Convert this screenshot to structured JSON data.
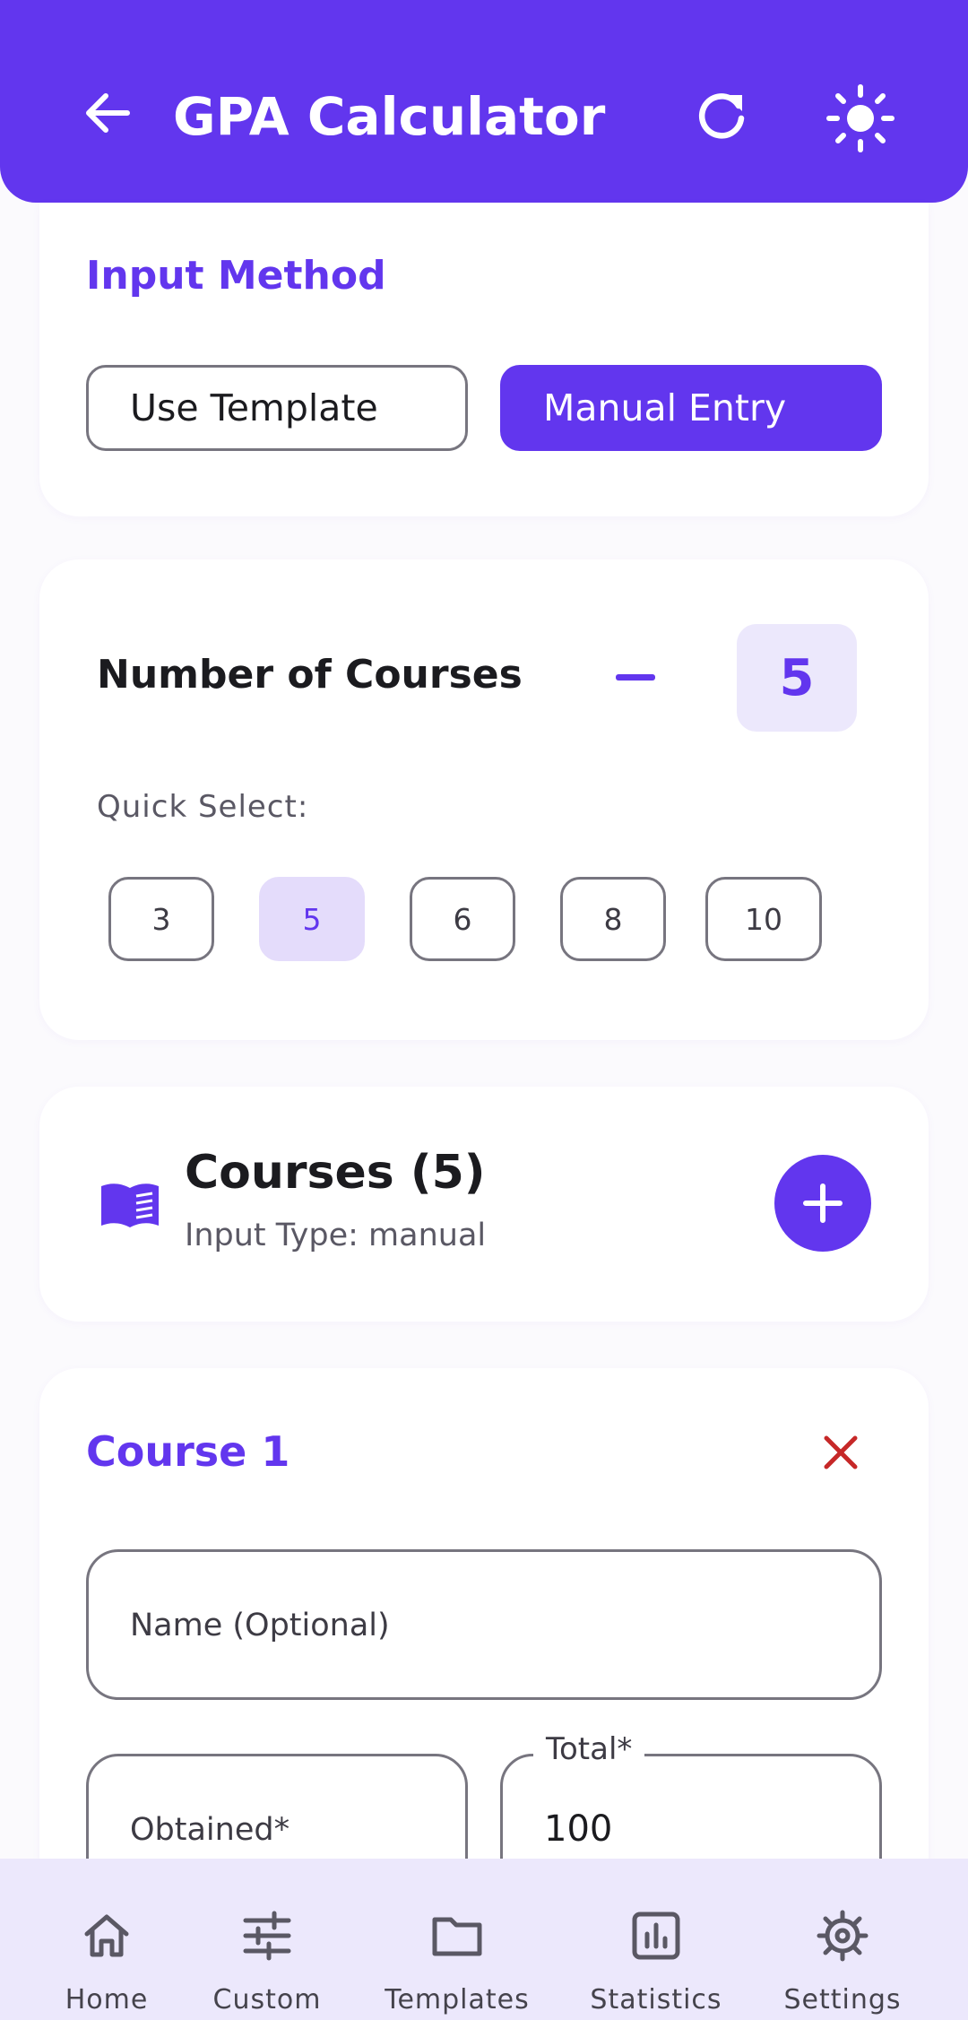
{
  "app": {
    "title": "GPA Calculator",
    "accent": "#6236EE",
    "icons": {
      "back": "arrow-left-icon",
      "refresh": "refresh-icon",
      "theme": "sun-icon"
    }
  },
  "input_method": {
    "title": "Input Method",
    "options": [
      "Use Template",
      "Manual Entry"
    ],
    "selected": "Manual Entry"
  },
  "courses_count": {
    "label": "Number of Courses",
    "value": "5",
    "quick_select_label": "Quick Select:",
    "quick_options": [
      "3",
      "5",
      "6",
      "8",
      "10"
    ],
    "selected": "5"
  },
  "courses_header": {
    "title": "Courses (5)",
    "subtitle": "Input Type: manual",
    "icon": "book-icon",
    "add_icon": "plus-icon"
  },
  "course_1": {
    "title": "Course 1",
    "remove_icon": "close-icon",
    "name_placeholder": "Name (Optional)",
    "obtained_placeholder": "Obtained*",
    "total_label": "Total*",
    "total_value": "100"
  },
  "bottom_nav": {
    "items": [
      {
        "label": "Home",
        "icon": "home-icon"
      },
      {
        "label": "Custom",
        "icon": "sliders-icon"
      },
      {
        "label": "Templates",
        "icon": "folder-icon"
      },
      {
        "label": "Statistics",
        "icon": "chart-icon"
      },
      {
        "label": "Settings",
        "icon": "gear-icon"
      }
    ]
  }
}
